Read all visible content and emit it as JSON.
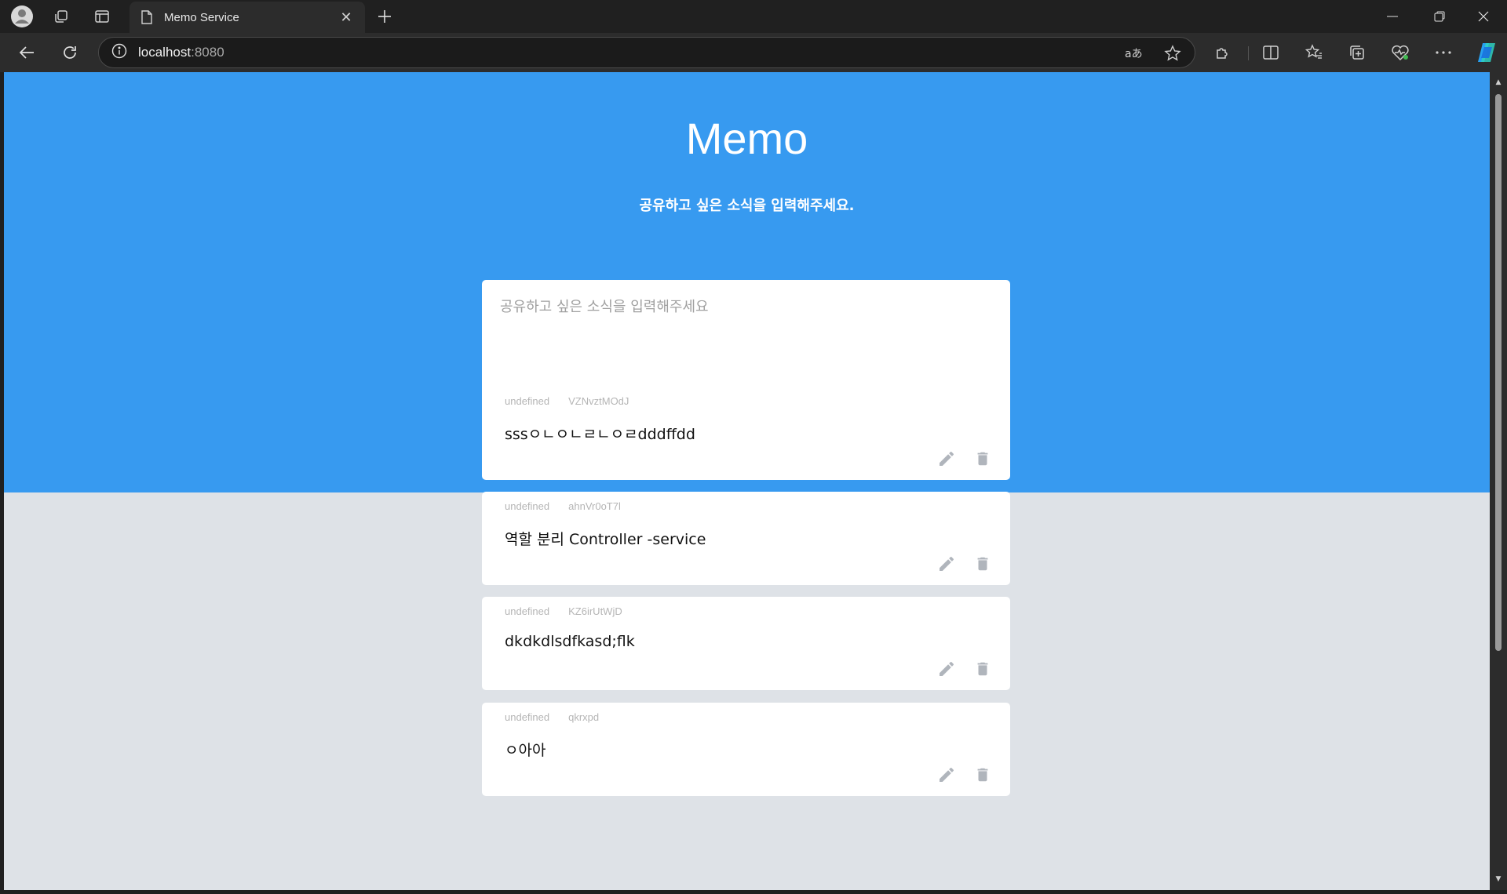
{
  "browser": {
    "tab_title": "Memo Service",
    "url_host": "localhost",
    "url_port": ":8080"
  },
  "page": {
    "title": "Memo",
    "subtitle": "공유하고 싶은 소식을 입력해주세요.",
    "composer_placeholder": "공유하고 싶은 소식을 입력해주세요"
  },
  "memos": [
    {
      "author": "undefined",
      "id": "VZNvztMOdJ",
      "text": "sssㅇㄴㅇㄴㄹㄴㅇㄹdddffdd"
    },
    {
      "author": "undefined",
      "id": "ahnVr0oT7l",
      "text": "역할 분리 Controller -service"
    },
    {
      "author": "undefined",
      "id": "KZ6irUtWjD",
      "text": "dkdkdlsdfkasd;flk"
    },
    {
      "author": "undefined",
      "id": "qkrxpd",
      "text": "ㅇ아아"
    }
  ],
  "colors": {
    "hero_bg": "#379af0",
    "page_bg": "#dee2e7",
    "icon_gray": "#b0b5bc"
  }
}
